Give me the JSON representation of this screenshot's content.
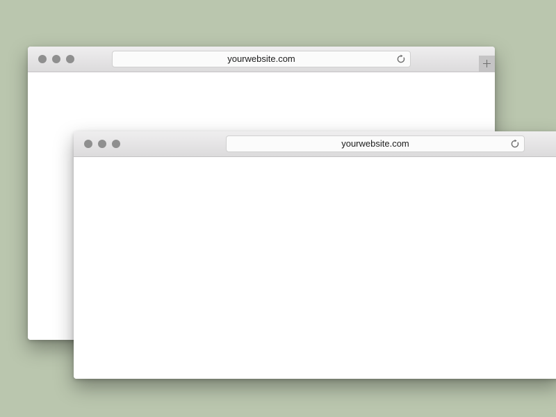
{
  "colors": {
    "desktop_background": "#bac6ae",
    "toolbar_gradient_top": "#efeeef",
    "toolbar_gradient_bottom": "#dcdbdc",
    "traffic_light_dot": "#8f8f8f"
  },
  "windows": [
    {
      "id": "back",
      "address_bar": {
        "url": "yourwebsite.com"
      },
      "icons": {
        "reload": "reload-icon",
        "new_tab": "plus-icon"
      }
    },
    {
      "id": "front",
      "address_bar": {
        "url": "yourwebsite.com"
      },
      "icons": {
        "reload": "reload-icon"
      }
    }
  ]
}
